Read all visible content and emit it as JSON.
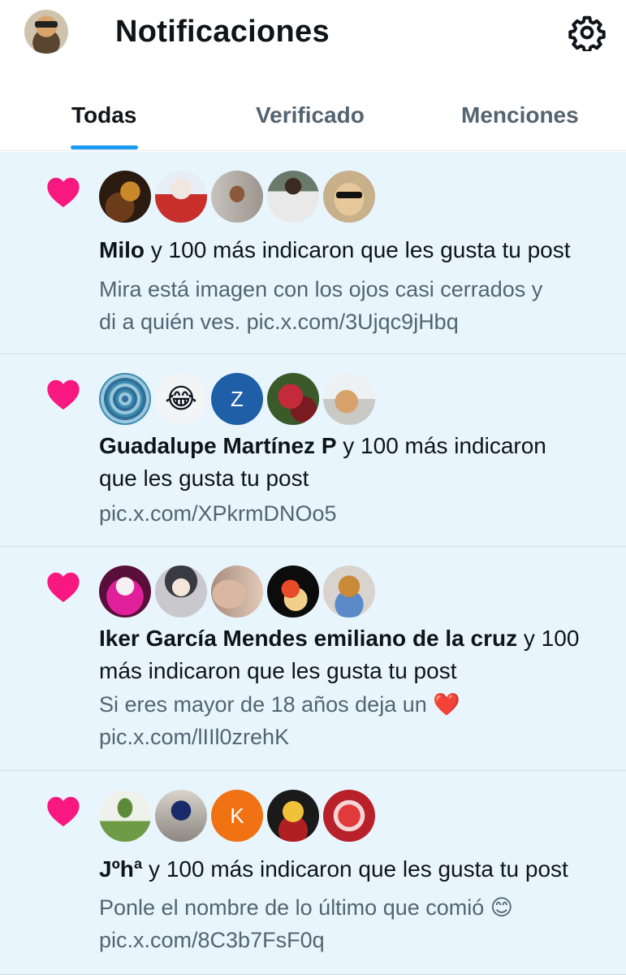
{
  "header": {
    "title": "Notificaciones"
  },
  "tabs": [
    {
      "label": "Todas",
      "active": true
    },
    {
      "label": "Verificado",
      "active": false
    },
    {
      "label": "Menciones",
      "active": false
    }
  ],
  "colors": {
    "accent": "#1d9bf0",
    "heart": "#f91880",
    "item_bg": "#e8f5fd",
    "muted": "#536471"
  },
  "notifications": [
    {
      "name": "Milo",
      "action": " y 100 más indicaron que les gusta tu post",
      "preview_lines": [
        "Mira está imagen con los ojos casi cerrados y",
        "di a quién ves. pic.x.com/3Ujqc9jHbq"
      ],
      "avatars": [
        "photo",
        "photo",
        "photo",
        "photo",
        "photo"
      ]
    },
    {
      "name": "Guadalupe Martínez P",
      "action": " y 100 más indicaron",
      "action_line2": "que les gusta tu post",
      "preview_lines": [
        "pic.x.com/XPkrmDNOo5"
      ],
      "avatars": [
        "photo",
        "emoji",
        "Z",
        "photo",
        "photo"
      ],
      "avatar_emoji": "😂"
    },
    {
      "name": "Iker García Mendes emiliano de la cruz",
      "action": " y 100",
      "action_line2": "más indicaron que les gusta tu post",
      "preview_lines": [
        "Si eres mayor de 18 años deja un ❤️",
        "pic.x.com/lIIl0zrehK"
      ],
      "avatars": [
        "photo",
        "photo",
        "photo",
        "photo",
        "photo"
      ]
    },
    {
      "name": "Jºhª",
      "action": " y 100 más indicaron que les gusta tu post",
      "preview_lines": [
        "Ponle el nombre de lo último que comió 😊",
        "pic.x.com/8C3b7FsF0q"
      ],
      "avatars": [
        "photo",
        "photo",
        "K",
        "photo",
        "photo"
      ]
    }
  ]
}
